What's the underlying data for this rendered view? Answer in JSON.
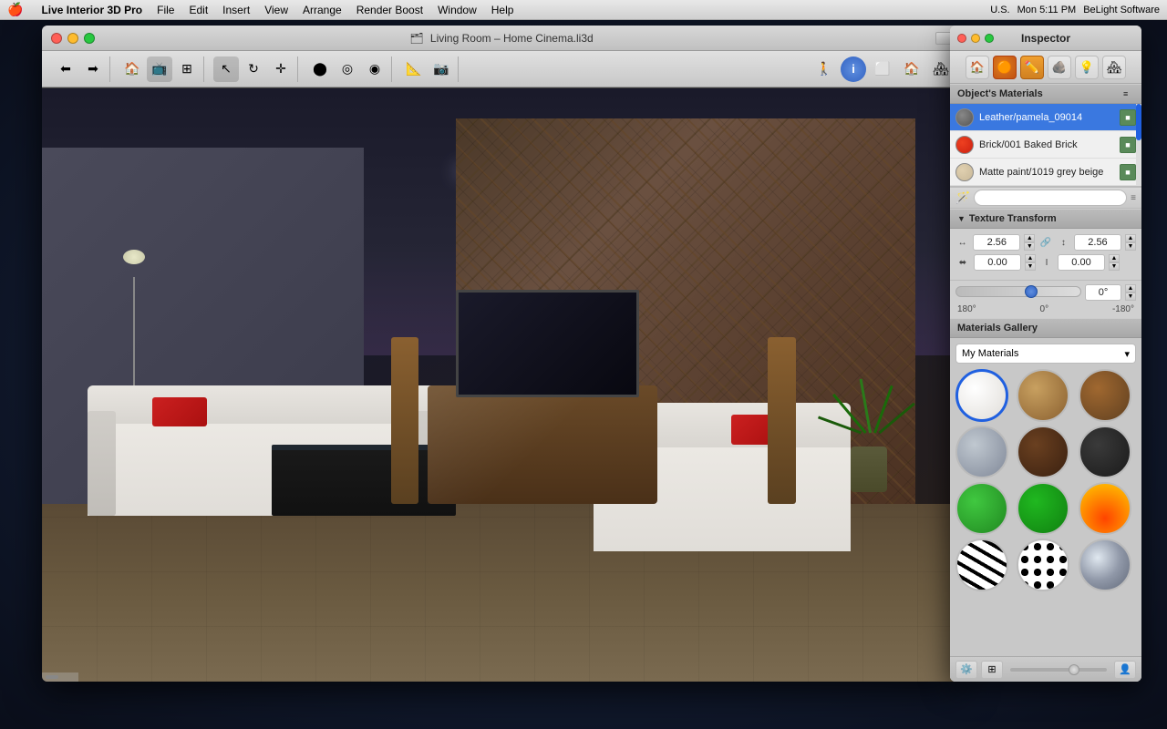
{
  "menubar": {
    "apple": "🍎",
    "items": [
      "Live Interior 3D Pro",
      "File",
      "Edit",
      "Insert",
      "View",
      "Arrange",
      "Render Boost",
      "Window",
      "Help"
    ],
    "right": {
      "time": "Mon 5:11 PM",
      "brand": "BeLight Software",
      "locale": "U.S."
    }
  },
  "window": {
    "title": "Living Room – Home Cinema.li3d",
    "titleIcon": "🗂"
  },
  "inspector": {
    "title": "Inspector",
    "tabs": [
      {
        "label": "🏠",
        "name": "home"
      },
      {
        "label": "🔴",
        "name": "object"
      },
      {
        "label": "✏️",
        "name": "edit",
        "active": true
      },
      {
        "label": "🪨",
        "name": "material"
      },
      {
        "label": "💡",
        "name": "light"
      },
      {
        "label": "🏠",
        "name": "room"
      }
    ],
    "objectsMaterialsTitle": "Object's Materials",
    "materials": [
      {
        "name": "Leather/pamela_09014",
        "swatchColor": "#888",
        "swatchType": "dark",
        "selected": true
      },
      {
        "name": "Brick/001 Baked Brick",
        "swatchColor": "#cc3010",
        "swatchType": "red"
      },
      {
        "name": "Matte paint/1019 grey beige",
        "swatchColor": "#d8c8a8",
        "swatchType": "beige"
      }
    ],
    "textureTransform": {
      "title": "Texture Transform",
      "scaleX": "2.56",
      "scaleY": "2.56",
      "offsetX": "0.00",
      "offsetY": "0.00",
      "angle": "0°",
      "angleMin": "180°",
      "angleCenter": "0°",
      "angleMax": "-180°"
    },
    "galleryTitle": "Materials Gallery",
    "galleryDropdown": "My Materials",
    "galleryItems": [
      {
        "type": "gi-white",
        "name": "white-material",
        "selected": true
      },
      {
        "type": "gi-wood1",
        "name": "wood-light"
      },
      {
        "type": "gi-wood2",
        "name": "wood-medium"
      },
      {
        "type": "gi-metal1",
        "name": "metal-gray"
      },
      {
        "type": "gi-wood3",
        "name": "wood-dark"
      },
      {
        "type": "gi-dark",
        "name": "dark-material"
      },
      {
        "type": "gi-green1",
        "name": "green-light"
      },
      {
        "type": "gi-green2",
        "name": "green-dark"
      },
      {
        "type": "gi-fire",
        "name": "fire-material"
      },
      {
        "type": "gi-zebra",
        "name": "zebra-material"
      },
      {
        "type": "gi-spots",
        "name": "spots-material"
      },
      {
        "type": "gi-silver",
        "name": "silver-material"
      }
    ]
  }
}
